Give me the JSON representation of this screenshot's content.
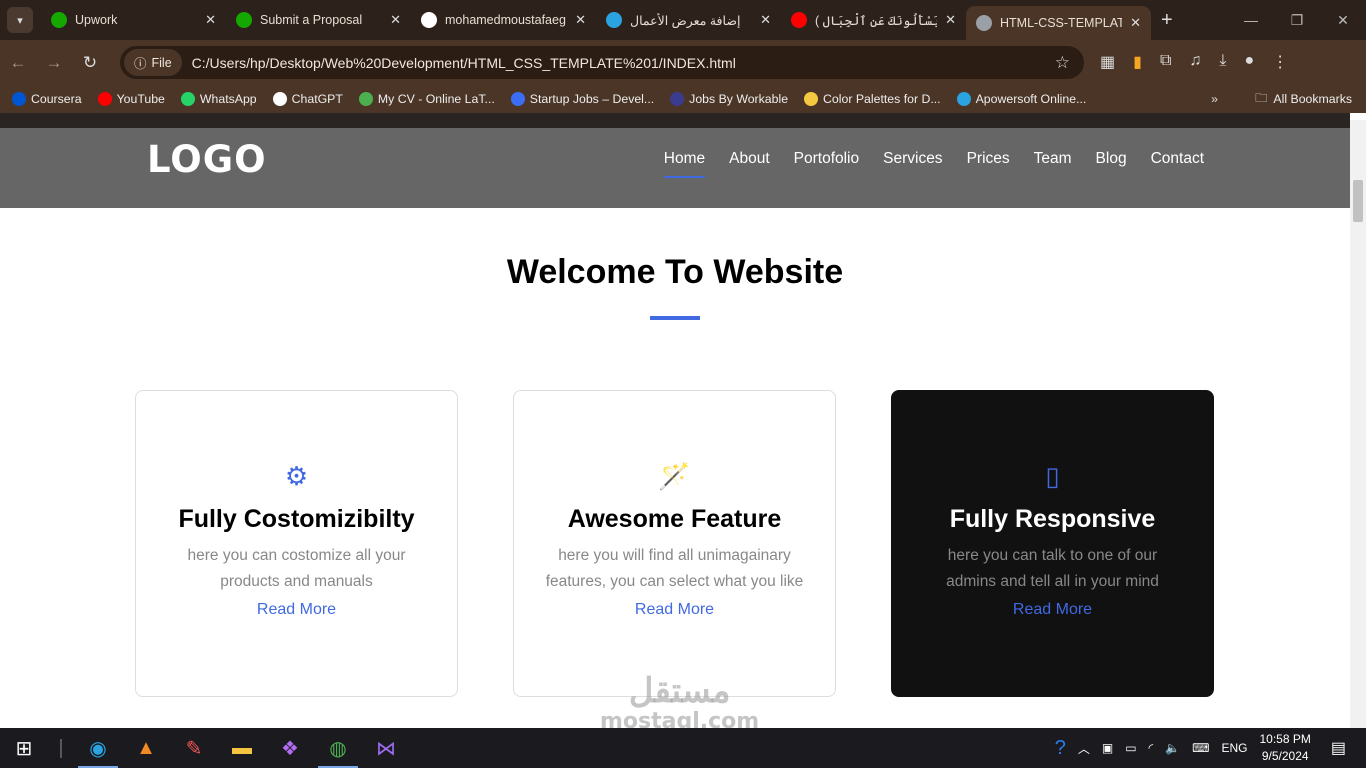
{
  "browser": {
    "tabs": [
      {
        "title": "Upwork",
        "icon": "upwork-icon",
        "color": "#14a800"
      },
      {
        "title": "Submit a Proposal",
        "icon": "upwork-icon",
        "color": "#14a800"
      },
      {
        "title": "mohamedmoustafaeg",
        "icon": "github-icon",
        "color": "#ffffff"
      },
      {
        "title": "إضافة معرض الأعمال",
        "icon": "mostaql-icon",
        "color": "#2aa3e0"
      },
      {
        "title": "( وَيَسْأَلُونَكَ عَنِ ٱلْجِبَالِ",
        "icon": "youtube-icon",
        "color": "#ff0000"
      },
      {
        "title": "HTML-CSS-TEMPLATE",
        "icon": "globe-icon",
        "color": "#9aa0a6",
        "active": true
      }
    ],
    "file_chip": "File",
    "url": "C:/Users/hp/Desktop/Web%20Development/HTML_CSS_TEMPLATE%201/INDEX.html",
    "bookmarks": [
      {
        "label": "Coursera",
        "color": "#0056d2"
      },
      {
        "label": "YouTube",
        "color": "#ff0000"
      },
      {
        "label": "WhatsApp",
        "color": "#25d366"
      },
      {
        "label": "ChatGPT",
        "color": "#ffffff"
      },
      {
        "label": "My CV - Online LaT...",
        "color": "#4caf50"
      },
      {
        "label": "Startup Jobs – Devel...",
        "color": "#3b6ef5"
      },
      {
        "label": "Jobs By Workable",
        "color": "#3b3b8f"
      },
      {
        "label": "Color Palettes for D...",
        "color": "#f5c842"
      },
      {
        "label": "Apowersoft Online...",
        "color": "#2aa3e0"
      }
    ],
    "all_bookmarks": "All Bookmarks"
  },
  "site": {
    "logo": "LOGO",
    "menu": [
      "Home",
      "About",
      "Portofolio",
      "Services",
      "Prices",
      "Team",
      "Blog",
      "Contact"
    ],
    "active_menu": "Home",
    "title": "Welcome To Website",
    "accent": "#4169e1",
    "cards": [
      {
        "icon": "gears-icon",
        "title": "Fully Costomizibilty",
        "text": "here you can costomize all your products and manuals",
        "link": "Read More"
      },
      {
        "icon": "magic-wand-icon",
        "title": "Awesome Feature",
        "text": "here you will find all unimagainary features, you can select what you like",
        "link": "Read More"
      },
      {
        "icon": "mobile-phone-icon",
        "title": "Fully Responsive",
        "text": "here you can talk to one of our admins and tell all in your mind",
        "link": "Read More"
      }
    ]
  },
  "watermark": {
    "arabic": "مستقل",
    "latin": "mostaql.com"
  },
  "taskbar": {
    "lang": "ENG",
    "time": "10:58 PM",
    "date": "9/5/2024"
  }
}
